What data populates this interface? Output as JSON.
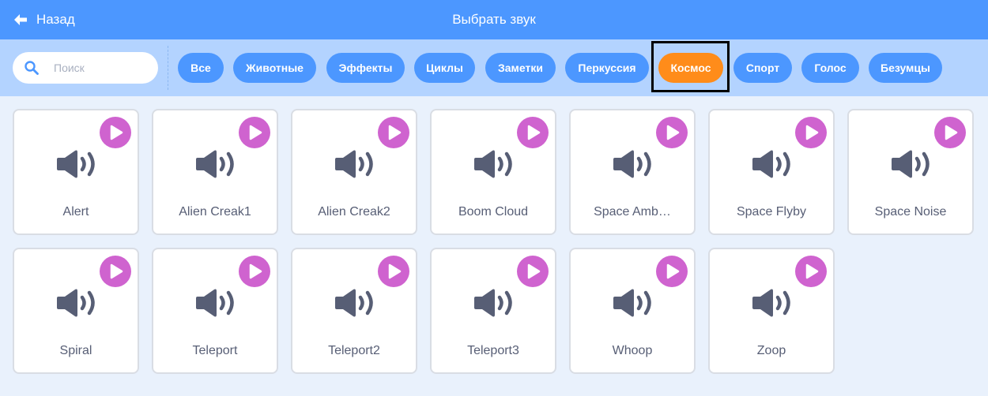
{
  "header": {
    "back_label": "Назад",
    "title": "Выбрать звук"
  },
  "search": {
    "placeholder": "Поиск"
  },
  "tags": [
    {
      "label": "Все"
    },
    {
      "label": "Животные"
    },
    {
      "label": "Эффекты"
    },
    {
      "label": "Циклы"
    },
    {
      "label": "Заметки"
    },
    {
      "label": "Перкуссия"
    },
    {
      "label": "Космос",
      "selected": true
    },
    {
      "label": "Спорт"
    },
    {
      "label": "Голос"
    },
    {
      "label": "Безумцы"
    }
  ],
  "sounds": [
    {
      "name": "Alert"
    },
    {
      "name": "Alien Creak1"
    },
    {
      "name": "Alien Creak2"
    },
    {
      "name": "Boom Cloud"
    },
    {
      "name": "Space Amb…"
    },
    {
      "name": "Space Flyby"
    },
    {
      "name": "Space Noise"
    },
    {
      "name": "Spiral"
    },
    {
      "name": "Teleport"
    },
    {
      "name": "Teleport2"
    },
    {
      "name": "Teleport3"
    },
    {
      "name": "Whoop"
    },
    {
      "name": "Zoop"
    }
  ],
  "colors": {
    "header_bg": "#4c97ff",
    "filter_bg": "#b3d3ff",
    "tag": "#4c97ff",
    "tag_selected": "#ff8c1a",
    "play_button": "#cf63cf",
    "speaker_icon": "#575e75",
    "page_bg": "#e9f1fc"
  },
  "icons": {
    "back": "arrow-left-icon",
    "search": "magnifier-icon",
    "play": "play-icon",
    "sound": "speaker-icon"
  }
}
